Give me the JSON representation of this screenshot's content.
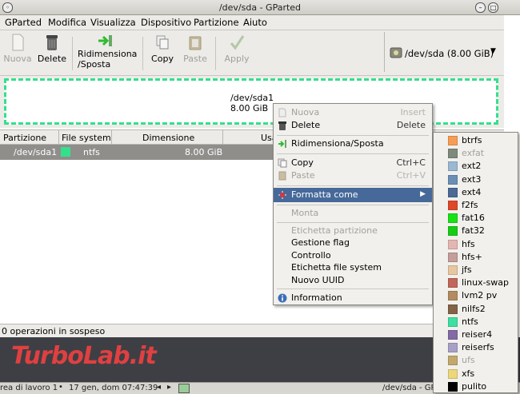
{
  "window": {
    "title": "/dev/sda - GParted"
  },
  "menubar": [
    "GParted",
    "Modifica",
    "Visualizza",
    "Dispositivo",
    "Partizione",
    "Aiuto"
  ],
  "toolbar": {
    "new": "Nuova",
    "delete": "Delete",
    "resize_line1": "Ridimensiona",
    "resize_line2": "/Sposta",
    "copy": "Copy",
    "paste": "Paste",
    "apply": "Apply",
    "device": "/dev/sda   (8.00 GiB)"
  },
  "disk_graphic": {
    "name": "/dev/sda1",
    "size": "8.00 GiB",
    "fs_color": "#35e08c"
  },
  "table": {
    "columns": [
      "Partizione",
      "File system",
      "Dimensione",
      "Usa"
    ],
    "rows": [
      {
        "partition": "/dev/sda1",
        "filesystem": "ntfs",
        "size": "8.00 GiB",
        "color": "#35e08c"
      }
    ]
  },
  "context_menu": {
    "new": "Nuova",
    "new_acc": "Insert",
    "delete": "Delete",
    "delete_acc": "Delete",
    "resize": "Ridimensiona/Sposta",
    "copy": "Copy",
    "copy_acc": "Ctrl+C",
    "paste": "Paste",
    "paste_acc": "Ctrl+V",
    "format": "Formatta come",
    "mount": "Monta",
    "label_partition": "Etichetta partizione",
    "manage_flags": "Gestione flag",
    "check": "Controllo",
    "label_fs": "Etichetta file system",
    "new_uuid": "Nuovo UUID",
    "info": "Information"
  },
  "filesystems": [
    {
      "name": "btrfs",
      "color": "#f79d53",
      "enabled": true
    },
    {
      "name": "exfat",
      "color": "#7e8a7c",
      "enabled": false
    },
    {
      "name": "ext2",
      "color": "#9bb8d3",
      "enabled": true
    },
    {
      "name": "ext3",
      "color": "#6b8eb5",
      "enabled": true
    },
    {
      "name": "ext4",
      "color": "#4b6a96",
      "enabled": true
    },
    {
      "name": "f2fs",
      "color": "#e0462a",
      "enabled": true
    },
    {
      "name": "fat16",
      "color": "#16e316",
      "enabled": true
    },
    {
      "name": "fat32",
      "color": "#16cd16",
      "enabled": true
    },
    {
      "name": "hfs",
      "color": "#e4b6b2",
      "enabled": true
    },
    {
      "name": "hfs+",
      "color": "#c49e98",
      "enabled": true
    },
    {
      "name": "jfs",
      "color": "#e7c79f",
      "enabled": true
    },
    {
      "name": "linux-swap",
      "color": "#c1665a",
      "enabled": true
    },
    {
      "name": "lvm2 pv",
      "color": "#b38b5e",
      "enabled": true
    },
    {
      "name": "nilfs2",
      "color": "#826346",
      "enabled": true
    },
    {
      "name": "ntfs",
      "color": "#3de0a2",
      "enabled": true
    },
    {
      "name": "reiser4",
      "color": "#826aa6",
      "enabled": true
    },
    {
      "name": "reiserfs",
      "color": "#a99fc6",
      "enabled": true
    },
    {
      "name": "ufs",
      "color": "#c2a86b",
      "enabled": false
    },
    {
      "name": "xfs",
      "color": "#ecd77a",
      "enabled": true
    },
    {
      "name": "pulito",
      "color": "#000000",
      "enabled": true
    }
  ],
  "status": "0 operazioni in sospeso",
  "watermark": "TurboLab.it",
  "panel": {
    "workspace": "rea di lavoro 1",
    "clock": "17 gen, dom 07:47:39",
    "task": "/dev/sda - GP"
  }
}
